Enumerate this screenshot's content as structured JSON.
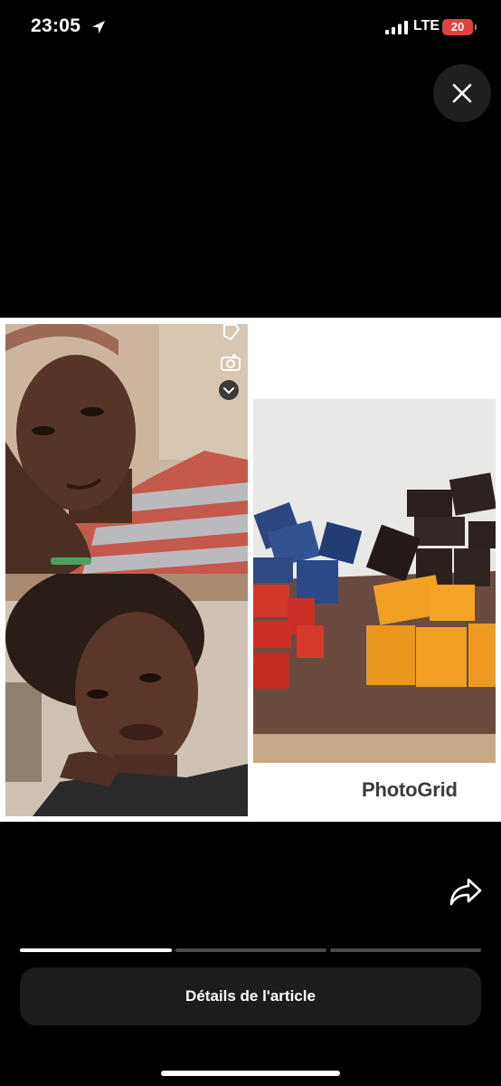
{
  "status_bar": {
    "time": "23:05",
    "network": "LTE",
    "battery": "20",
    "icons": [
      "location-arrow-icon",
      "signal-icon",
      "battery-icon"
    ]
  },
  "viewer": {
    "close_icon": "close-icon",
    "share_icon": "share-icon",
    "image": {
      "watermark": "PhotoGrid",
      "panels": [
        "woman-portrait-top",
        "woman-portrait-bottom",
        "soap-bars"
      ],
      "overlay_icons": [
        "sticker-icon",
        "camera-icon",
        "chevron-down-icon"
      ]
    },
    "progress": {
      "segments": 3,
      "active_index": 0
    },
    "details_label": "Détails de l'article"
  },
  "colors": {
    "background": "#000000",
    "button_bg": "#1c1c1c",
    "battery": "#e24141",
    "progress_active": "#ffffff",
    "progress_inactive": "#4b4b4b"
  }
}
